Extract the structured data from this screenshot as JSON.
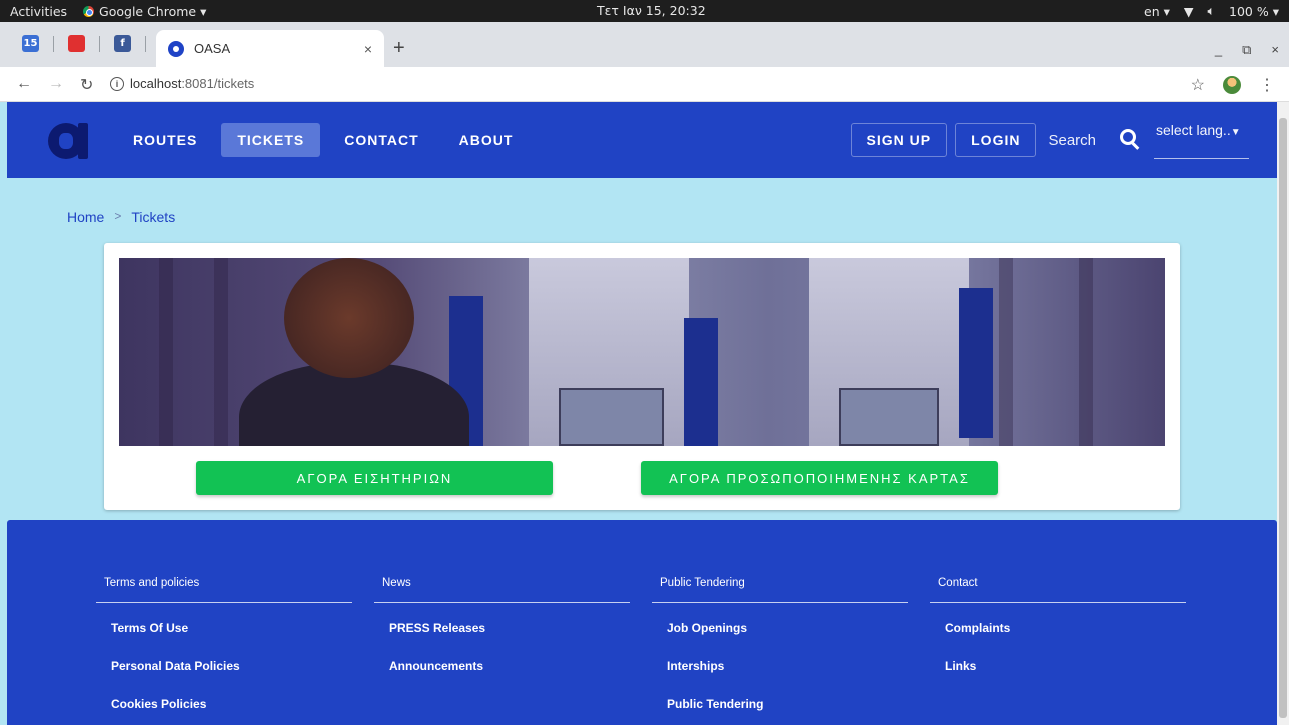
{
  "os": {
    "activities": "Activities",
    "app_name": "Google Chrome ▾",
    "clock": "Τετ Ιαν 15, 20:32",
    "lang": "en ▾",
    "battery": "100 % ▾"
  },
  "browser": {
    "pinned": [
      "15",
      "",
      "f",
      ""
    ],
    "tab_title": "OASA",
    "tab_close": "×",
    "new_tab": "+",
    "url_host": "localhost",
    "url_rest": ":8081/tickets",
    "window_controls": [
      "_",
      "⧉",
      "×"
    ]
  },
  "header": {
    "menu": [
      {
        "label": "ROUTES",
        "active": false
      },
      {
        "label": "TICKETS",
        "active": true
      },
      {
        "label": "CONTACT",
        "active": false
      },
      {
        "label": "ABOUT",
        "active": false
      }
    ],
    "signup": "SIGN UP",
    "login": "LOGIN",
    "search_label": "Search",
    "lang_placeholder": "select lang.."
  },
  "breadcrumb": {
    "home": "Home",
    "separator": ">",
    "current": "Tickets"
  },
  "card": {
    "buy_tickets": "ΑΓΟΡΑ ΕΙΣΗΤΗΡΙΩΝ",
    "buy_card": "ΑΓΟΡΑ ΠΡΟΣΩΠΟΠΟΙΗΜΕΝΗΣ ΚΑΡΤΑΣ"
  },
  "footer": {
    "columns": [
      {
        "heading": "Terms and policies",
        "links": [
          "Terms Of Use",
          "Personal Data Policies",
          "Cookies Policies"
        ]
      },
      {
        "heading": "News",
        "links": [
          "PRESS Releases",
          "Announcements"
        ]
      },
      {
        "heading": "Public Tendering",
        "links": [
          "Job Openings",
          "Interships",
          "Public Tendering"
        ]
      },
      {
        "heading": "Contact",
        "links": [
          "Complaints",
          "Links"
        ]
      }
    ]
  },
  "colors": {
    "brand_blue": "#2043c4",
    "page_bg": "#b2e5f3",
    "green": "#12c254",
    "active_tab": "#5a78d8"
  }
}
